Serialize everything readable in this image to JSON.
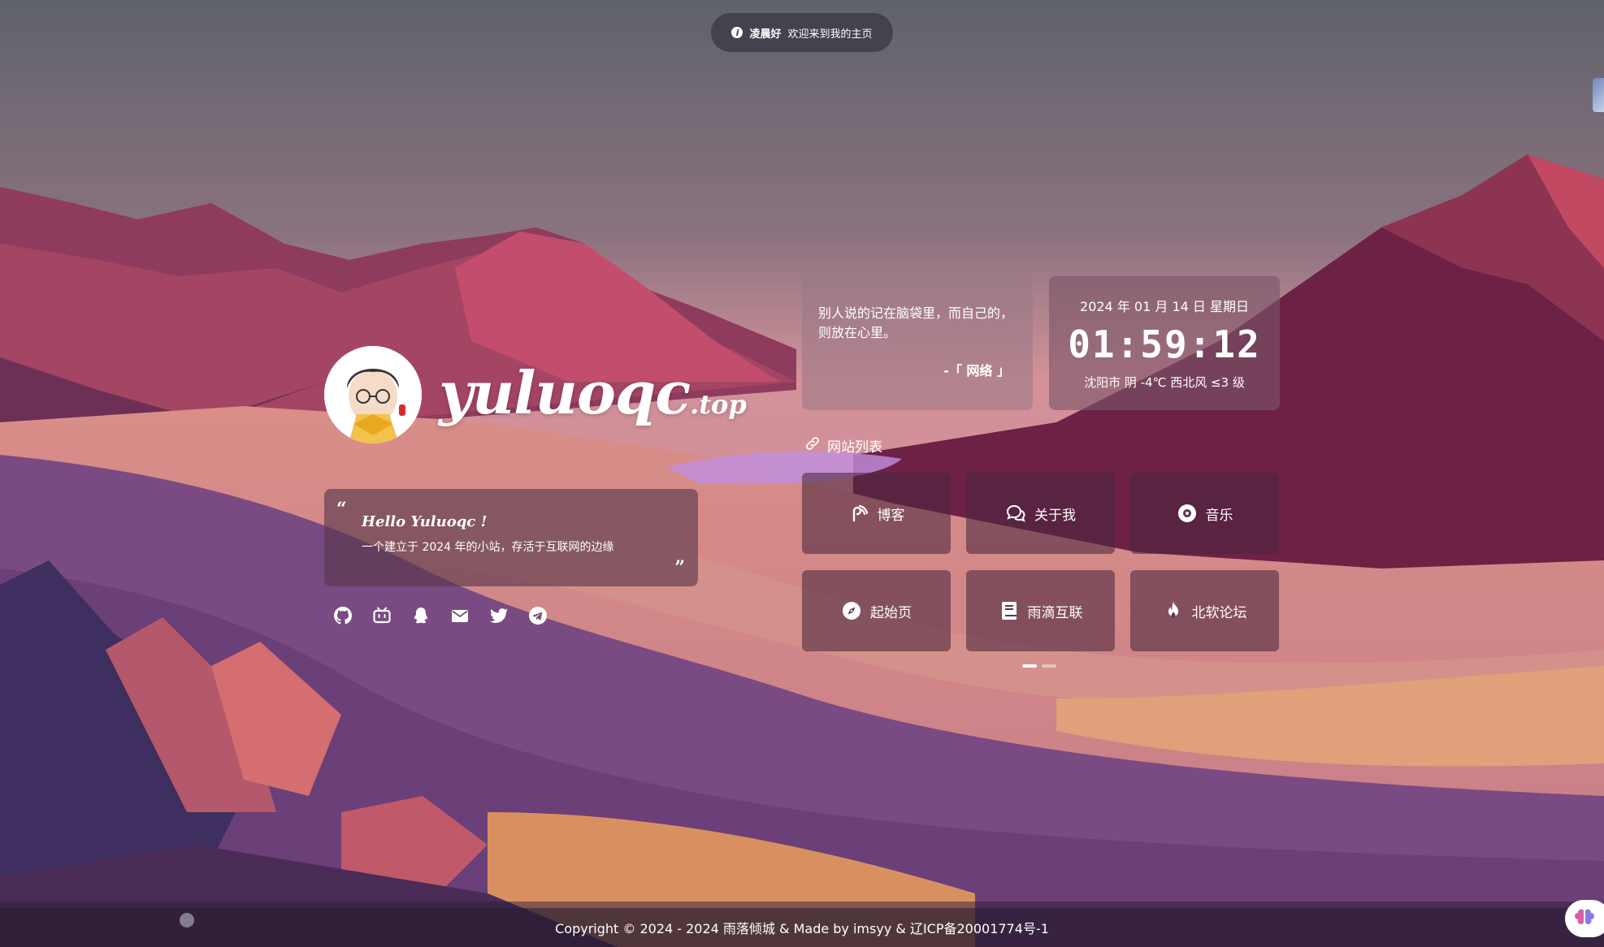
{
  "toast": {
    "icon": "info-icon",
    "greeting": "凌晨好",
    "message": "欢迎来到我的主页"
  },
  "profile": {
    "site_name": "yuluoqc",
    "site_tld": ".top",
    "hello_title": "Hello Yuluoqc !",
    "hello_text": "一个建立于 2024 年的小站，存活于互联网的边缘",
    "quote_open": "“",
    "quote_close": "”"
  },
  "socials": [
    {
      "name": "github-icon"
    },
    {
      "name": "bilibili-icon"
    },
    {
      "name": "qq-icon"
    },
    {
      "name": "email-icon"
    },
    {
      "name": "twitter-icon"
    },
    {
      "name": "telegram-icon"
    }
  ],
  "quote_card": {
    "text": "别人说的记在脑袋里，而自己的，则放在心里。",
    "source": "-「 网络 」"
  },
  "time_card": {
    "date": "2024 年 01 月 14 日 星期日",
    "time": "01:59:12",
    "weather": "沈阳市 阴 -4℃ 西北风 ≤3 级"
  },
  "links": {
    "heading": "网站列表",
    "heading_icon": "link-icon",
    "items": [
      {
        "label": "博客",
        "icon": "blog-icon"
      },
      {
        "label": "关于我",
        "icon": "chat-icon"
      },
      {
        "label": "音乐",
        "icon": "music-icon"
      },
      {
        "label": "起始页",
        "icon": "compass-icon"
      },
      {
        "label": "雨滴互联",
        "icon": "book-icon"
      },
      {
        "label": "北软论坛",
        "icon": "fire-icon"
      }
    ],
    "pages": 2,
    "active_page": 1
  },
  "footer": {
    "text": "Copyright © 2024 - 2024 雨落倾城 & Made by imsyy & 辽ICP备20001774号-1"
  }
}
